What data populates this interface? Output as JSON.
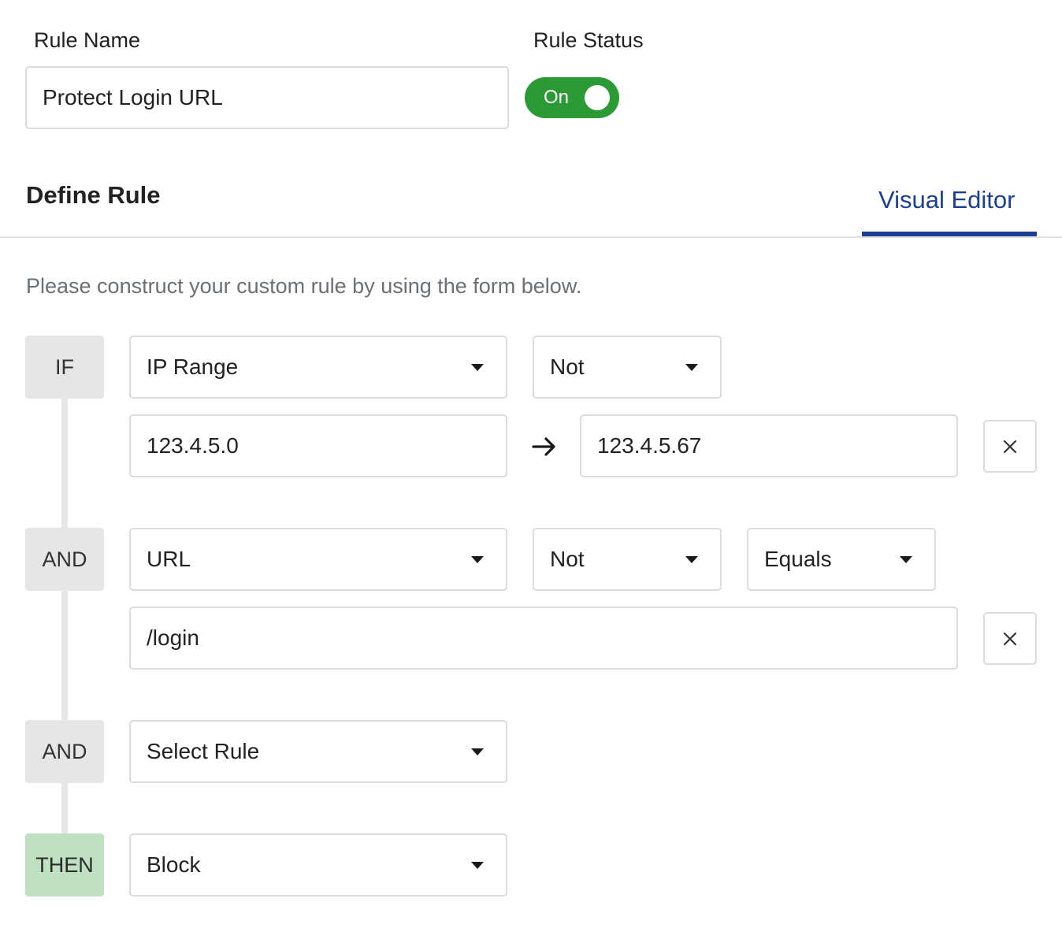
{
  "rule_name": {
    "label": "Rule Name",
    "value": "Protect Login URL"
  },
  "rule_status": {
    "label": "Rule Status",
    "toggle_text": "On",
    "enabled": true
  },
  "define_rule": {
    "title": "Define Rule",
    "active_tab": "Visual Editor"
  },
  "instructions": "Please construct your custom rule by using the form below.",
  "conditions": [
    {
      "operator": "IF",
      "field": "IP Range",
      "modifier": "Not",
      "range_start": "123.4.5.0",
      "range_end": "123.4.5.67"
    },
    {
      "operator": "AND",
      "field": "URL",
      "modifier": "Not",
      "comparison": "Equals",
      "value": "/login"
    },
    {
      "operator": "AND",
      "field": "Select Rule"
    }
  ],
  "action": {
    "operator": "THEN",
    "value": "Block"
  },
  "colors": {
    "toggle_on": "#2a9a35",
    "tab_active": "#1c3f94",
    "then_tag": "#bfe0c1",
    "tag_bg": "#e6e6e6",
    "border": "#dcdcdc"
  },
  "icons": {
    "dropdown": "caret-down-icon",
    "remove": "close-icon",
    "range": "arrow-right-icon"
  }
}
